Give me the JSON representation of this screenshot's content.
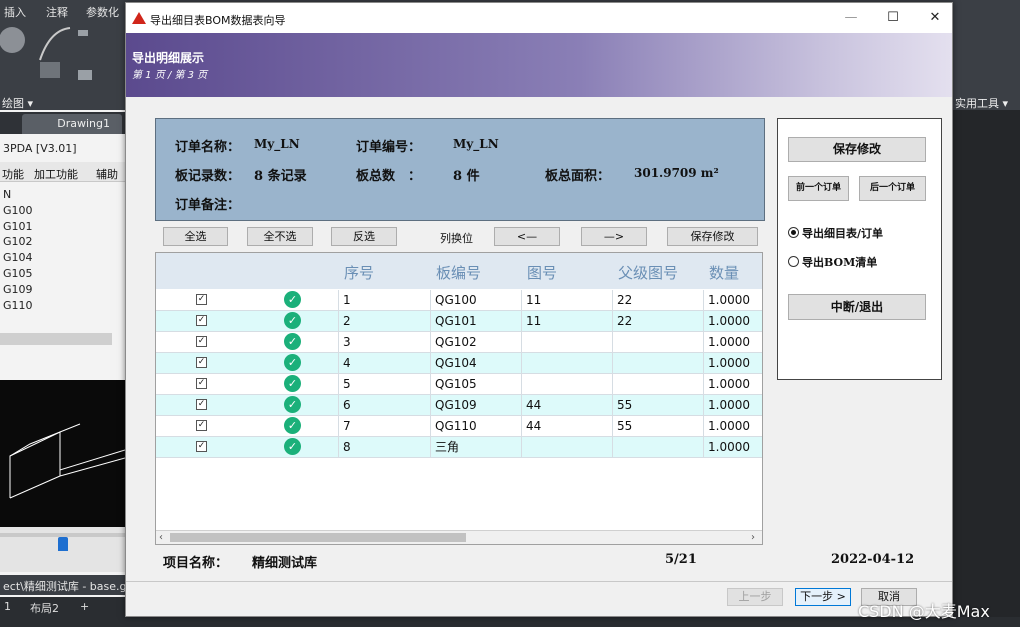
{
  "cad": {
    "menu": [
      "插入",
      "注释",
      "参数化"
    ],
    "draw_label": "绘图 ▾",
    "drawing_tab": "Drawing1",
    "pda_version": "3PDA [V3.01]",
    "func_tabs": [
      "功能",
      "加工功能",
      "辅助"
    ],
    "list_items": [
      "N",
      "G100",
      "G101",
      "G102",
      "G104",
      "G105",
      "G109",
      "G110"
    ],
    "file_path": "ect\\精细测试库 - base.g",
    "layout_tabs": [
      "1",
      "布局2",
      "+"
    ],
    "right_label": "实用工具 ▾"
  },
  "dialog": {
    "title": "导出细目表BOM数据表向导",
    "banner_title": "导出明细展示",
    "banner_sub": "第 1 页 / 第 3 页"
  },
  "info": {
    "order_name_label": "订单名称：",
    "order_name": "My_LN",
    "order_no_label": "订单编号：",
    "order_no": "My_LN",
    "records_label": "板记录数：",
    "records": "8 条记录",
    "boards_label": "板总数　：",
    "boards": "8 件",
    "area_label": "板总面积：",
    "area": "301.9709 m²",
    "remark_label": "订单备注："
  },
  "toolbar": {
    "select_all": "全选",
    "select_none": "全不选",
    "invert": "反选",
    "swap_label": "列换位",
    "left": "<—",
    "right": "—>",
    "save": "保存修改"
  },
  "grid": {
    "columns": [
      "序号",
      "板编号",
      "图号",
      "父级图号",
      "数量"
    ],
    "rows": [
      {
        "no": "1",
        "code": "QG100",
        "drawing": "11",
        "parent": "22",
        "qty": "1.0000"
      },
      {
        "no": "2",
        "code": "QG101",
        "drawing": "11",
        "parent": "22",
        "qty": "1.0000"
      },
      {
        "no": "3",
        "code": "QG102",
        "drawing": "",
        "parent": "",
        "qty": "1.0000"
      },
      {
        "no": "4",
        "code": "QG104",
        "drawing": "",
        "parent": "",
        "qty": "1.0000"
      },
      {
        "no": "5",
        "code": "QG105",
        "drawing": "",
        "parent": "",
        "qty": "1.0000"
      },
      {
        "no": "6",
        "code": "QG109",
        "drawing": "44",
        "parent": "55",
        "qty": "1.0000"
      },
      {
        "no": "7",
        "code": "QG110",
        "drawing": "44",
        "parent": "55",
        "qty": "1.0000"
      },
      {
        "no": "8",
        "code": "三角",
        "drawing": "",
        "parent": "",
        "qty": "1.0000"
      }
    ]
  },
  "footer": {
    "project_label": "项目名称：",
    "project": "精细测试库",
    "page": "5/21",
    "date": "2022-04-12"
  },
  "side": {
    "save": "保存修改",
    "prev_order": "前一个订单",
    "next_order": "后一个订单",
    "radio1": "导出细目表/订单",
    "radio2": "导出BOM清单",
    "abort": "中断/退出"
  },
  "nav": {
    "back": "上一步",
    "next": "下一步 >",
    "cancel": "取消"
  },
  "watermark": "CSDN @大麦Max"
}
